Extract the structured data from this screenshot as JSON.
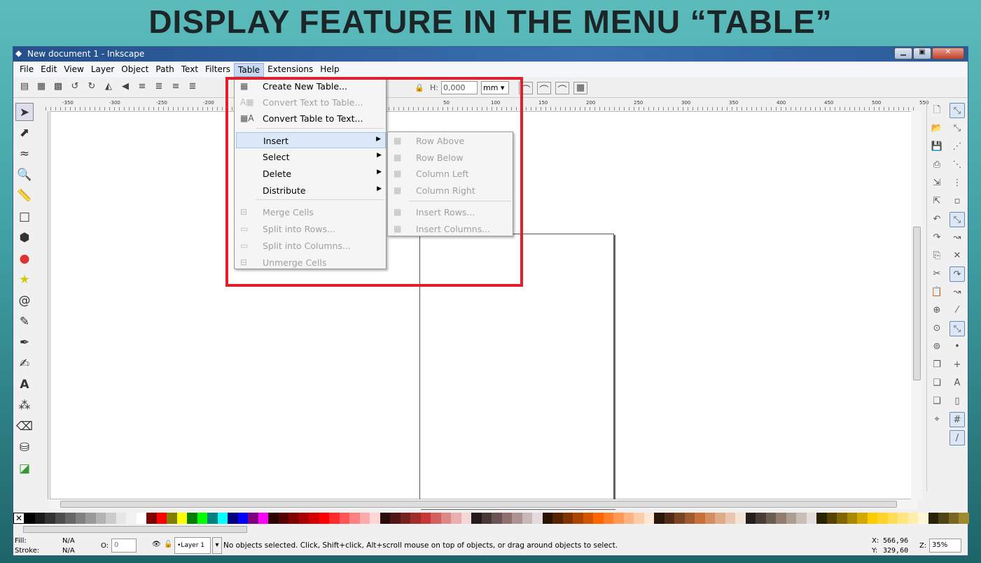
{
  "slide_title": "DISPLAY FEATURE IN THE MENU “TABLE”",
  "window": {
    "title": "New document 1 - Inkscape",
    "minimize": "▁",
    "maximize": "▣",
    "close": "✕"
  },
  "menubar": [
    "File",
    "Edit",
    "View",
    "Layer",
    "Object",
    "Path",
    "Text",
    "Filters",
    "Table",
    "Extensions",
    "Help"
  ],
  "toolbar": {
    "h_label": "H:",
    "h_value": "0,000",
    "unit": "mm"
  },
  "ruler_ticks": [
    "-350",
    "-300",
    "-250",
    "-200",
    "50",
    "100",
    "150",
    "200",
    "250",
    "300",
    "350",
    "400",
    "450",
    "500",
    "550"
  ],
  "table_menu": [
    {
      "label": "Create New Table...",
      "enabled": true,
      "icon": "table-new-icon"
    },
    {
      "label": "Convert Text to Table...",
      "enabled": false,
      "icon": "text-to-table-icon"
    },
    {
      "label": "Convert Table to Text...",
      "enabled": true,
      "icon": "table-to-text-icon"
    },
    {
      "label": "Insert",
      "enabled": true,
      "submenu": true
    },
    {
      "label": "Select",
      "enabled": true,
      "submenu": true
    },
    {
      "label": "Delete",
      "enabled": true,
      "submenu": true
    },
    {
      "label": "Distribute",
      "enabled": true,
      "submenu": true
    },
    {
      "label": "Merge Cells",
      "enabled": false,
      "icon": "merge-cells-icon"
    },
    {
      "label": "Split into Rows...",
      "enabled": false,
      "icon": "split-rows-icon"
    },
    {
      "label": "Split into Columns...",
      "enabled": false,
      "icon": "split-columns-icon"
    },
    {
      "label": "Unmerge Cells",
      "enabled": false,
      "icon": "unmerge-cells-icon"
    }
  ],
  "insert_submenu": [
    "Row Above",
    "Row Below",
    "Column Left",
    "Column Right",
    "Insert Rows...",
    "Insert Columns..."
  ],
  "palette": [
    "#000000",
    "#1a1a1a",
    "#333333",
    "#4d4d4d",
    "#666666",
    "#808080",
    "#999999",
    "#b3b3b3",
    "#cccccc",
    "#e6e6e6",
    "#f2f2f2",
    "#ffffff",
    "#800000",
    "#ff0000",
    "#808000",
    "#ffff00",
    "#008000",
    "#00ff00",
    "#008080",
    "#00ffff",
    "#000080",
    "#0000ff",
    "#800080",
    "#ff00ff",
    "#2b0000",
    "#550000",
    "#800000",
    "#aa0000",
    "#d40000",
    "#ff0000",
    "#ff2a2a",
    "#ff5555",
    "#ff8080",
    "#ffaaaa",
    "#ffd5d5",
    "#280b0b",
    "#501616",
    "#782121",
    "#a02c2c",
    "#c83737",
    "#d35f5f",
    "#de8787",
    "#e9afaf",
    "#f4d7d7",
    "#241c1c",
    "#483737",
    "#6c5353",
    "#916f6f",
    "#ac9393",
    "#c8b7b7",
    "#e3dbdb",
    "#2b1100",
    "#552200",
    "#803300",
    "#aa4400",
    "#d45500",
    "#ff6600",
    "#ff7f2a",
    "#ff9955",
    "#ffb380",
    "#ffccaa",
    "#ffe6d5",
    "#28170b",
    "#502d16",
    "#784421",
    "#a05a2c",
    "#c87137",
    "#d38d5f",
    "#deaa87",
    "#e9c6af",
    "#f4e3d7",
    "#241f1c",
    "#483e37",
    "#6c5d53",
    "#917c6f",
    "#ac9d93",
    "#c8beb7",
    "#e3dedb",
    "#2b2200",
    "#554400",
    "#806600",
    "#aa8800",
    "#d4aa00",
    "#ffcc00",
    "#ffd42a",
    "#ffdd55",
    "#ffe680",
    "#ffeeaa",
    "#fff6d5",
    "#28220b",
    "#504416",
    "#786721",
    "#a0892c"
  ],
  "status": {
    "fill_label": "Fill:",
    "fill_value": "N/A",
    "stroke_label": "Stroke:",
    "stroke_value": "N/A",
    "opacity_label": "O:",
    "opacity_value": "0",
    "layer": "•Layer 1",
    "message": "No objects selected. Click, Shift+click, Alt+scroll mouse on top of objects, or drag around objects to select.",
    "x_label": "X:",
    "x_value": "566,96",
    "y_label": "Y:",
    "y_value": "329,60",
    "zoom_label": "Z:",
    "zoom_value": "35%"
  }
}
